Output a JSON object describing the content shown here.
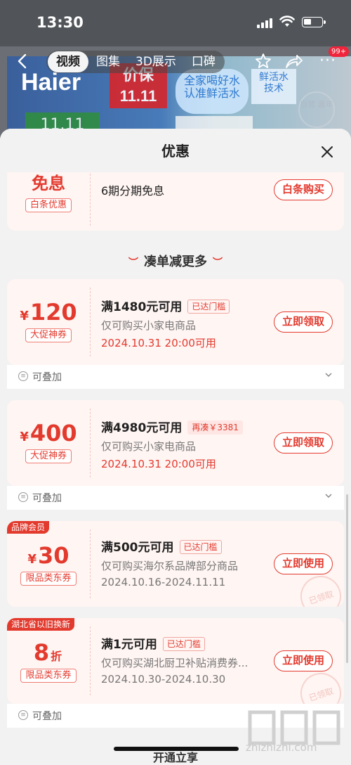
{
  "status_bar": {
    "time": "13:30"
  },
  "background": {
    "brand": "Haier",
    "price_tag_line1": "价保",
    "price_tag_line2": "11.11",
    "badge1_line1": "全家喝好水",
    "badge1_line2": "认准鲜活水",
    "badge2_line1": "鲜活水",
    "badge2_line2": "技术",
    "stamp_text": "自营\n嘉年",
    "green_text": "11.11"
  },
  "nav": {
    "tabs": [
      "视频",
      "图集",
      "3D展示",
      "口碑"
    ],
    "active_tab": 0,
    "message_badge": "99+"
  },
  "sheet": {
    "title": "优惠"
  },
  "top_card": {
    "amount": "免息",
    "tag": "白条优惠",
    "desc": "6期分期免息",
    "button": "白条购买"
  },
  "section_heading": "凑单减更多",
  "coupons": [
    {
      "currency": "¥",
      "amount": "120",
      "tag": "大促神券",
      "title": "满1480元可用",
      "status": "已达门槛",
      "scope": "仅可购买小家电商品",
      "date": "2024.10.31 20:00可用",
      "button": "立即领取",
      "stack_label": "可叠加"
    },
    {
      "currency": "¥",
      "amount": "400",
      "tag": "大促神券",
      "title": "满4980元可用",
      "status": "再凑￥3381",
      "scope": "仅可购买小家电商品",
      "date": "2024.10.31 20:00可用",
      "button": "立即领取",
      "stack_label": "可叠加"
    },
    {
      "corner": "品牌会员",
      "currency": "¥",
      "amount": "30",
      "tag": "限品类东券",
      "title": "满500元可用",
      "status": "已达门槛",
      "scope": "仅可购买海尔系品牌部分商品",
      "date": "2024.10.16-2024.11.11",
      "button": "立即使用",
      "stamp": "已领取"
    },
    {
      "corner": "湖北省以旧换新",
      "amount": "8",
      "unit": "折",
      "tag": "限品类东券",
      "title": "满1元可用",
      "status": "已达门槛",
      "scope": "仅可购买湖北厨卫补贴消费券...",
      "date": "2024.10.30-2024.10.30",
      "button": "立即使用",
      "stamp": "已领取",
      "stack_label": "可叠加"
    }
  ],
  "bottom_peek": "开通立享",
  "watermark": "zhizhizhi.com",
  "colors": {
    "accent": "#e33a2e",
    "sheet_bg": "#f2f2f2",
    "card_bg": "#ffffff",
    "card_pink": "#fff5f3"
  }
}
